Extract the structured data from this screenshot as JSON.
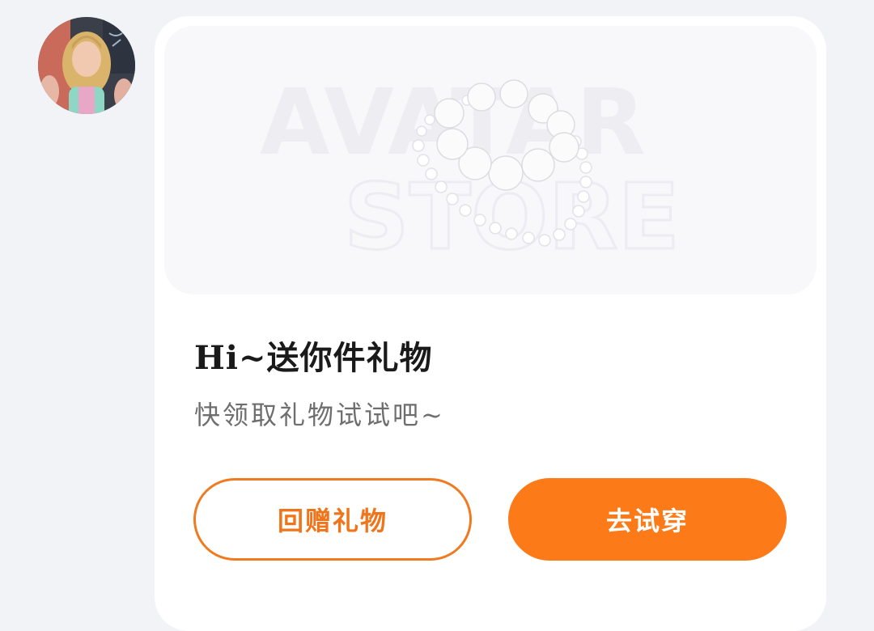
{
  "avatar": {
    "icon": "user-avatar-photo"
  },
  "banner": {
    "watermark_line1": "AVATAR",
    "watermark_line2": "STORE",
    "gift_icon": "pearl-necklace-icon"
  },
  "gift_card": {
    "title": "Hi~送你件礼物",
    "subtitle": "快领取礼物试试吧~",
    "return_gift_label": "回赠礼物",
    "try_on_label": "去试穿"
  },
  "colors": {
    "accent": "#fc7a17",
    "background": "#f2f3f7",
    "card": "#ffffff"
  }
}
